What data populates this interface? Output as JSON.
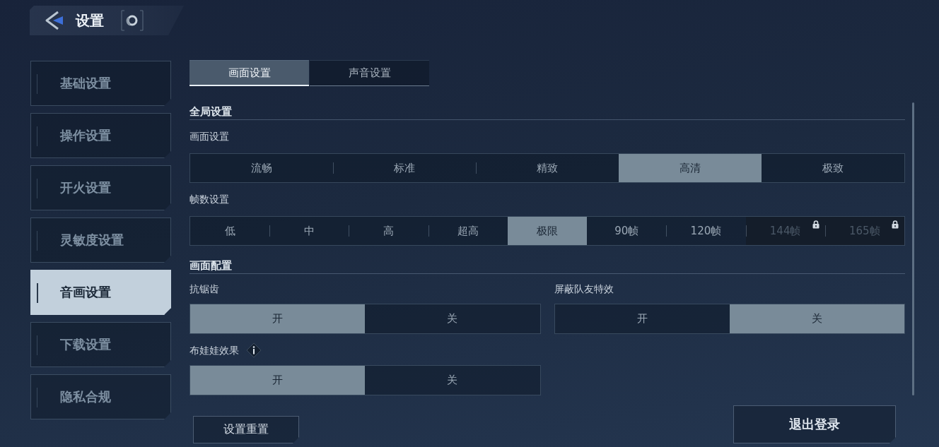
{
  "header": {
    "title": "设置"
  },
  "sidebar": {
    "items": [
      {
        "label": "基础设置",
        "selected": false
      },
      {
        "label": "操作设置",
        "selected": false
      },
      {
        "label": "开火设置",
        "selected": false
      },
      {
        "label": "灵敏度设置",
        "selected": false
      },
      {
        "label": "音画设置",
        "selected": true
      },
      {
        "label": "下载设置",
        "selected": false
      },
      {
        "label": "隐私合规",
        "selected": false
      }
    ]
  },
  "tabs": [
    {
      "label": "画面设置",
      "selected": true
    },
    {
      "label": "声音设置",
      "selected": false
    }
  ],
  "sections": [
    {
      "title": "全局设置",
      "settings": [
        {
          "kind": "segmented",
          "label": "画面设置",
          "info": false,
          "options": [
            {
              "label": "流畅",
              "selected": false,
              "locked": false
            },
            {
              "label": "标准",
              "selected": false,
              "locked": false
            },
            {
              "label": "精致",
              "selected": false,
              "locked": false
            },
            {
              "label": "高清",
              "selected": true,
              "locked": false
            },
            {
              "label": "极致",
              "selected": false,
              "locked": false
            }
          ]
        },
        {
          "kind": "segmented",
          "label": "帧数设置",
          "info": false,
          "options": [
            {
              "label": "低",
              "selected": false,
              "locked": false
            },
            {
              "label": "中",
              "selected": false,
              "locked": false
            },
            {
              "label": "高",
              "selected": false,
              "locked": false
            },
            {
              "label": "超高",
              "selected": false,
              "locked": false
            },
            {
              "label": "极限",
              "selected": true,
              "locked": false
            },
            {
              "label": "90帧",
              "selected": false,
              "locked": false
            },
            {
              "label": "120帧",
              "selected": false,
              "locked": false
            },
            {
              "label": "144帧",
              "selected": false,
              "locked": true
            },
            {
              "label": "165帧",
              "selected": false,
              "locked": true
            }
          ]
        }
      ]
    },
    {
      "title": "画面配置",
      "settings": [
        {
          "kind": "toggle",
          "label": "抗锯齿",
          "info": false,
          "options": [
            {
              "label": "开",
              "selected": true,
              "locked": false
            },
            {
              "label": "关",
              "selected": false,
              "locked": false
            }
          ]
        },
        {
          "kind": "toggle",
          "label": "屏蔽队友特效",
          "info": false,
          "options": [
            {
              "label": "开",
              "selected": false,
              "locked": false
            },
            {
              "label": "关",
              "selected": true,
              "locked": false
            }
          ]
        },
        {
          "kind": "toggle",
          "label": "布娃娃效果",
          "info": true,
          "options": [
            {
              "label": "开",
              "selected": true,
              "locked": false
            },
            {
              "label": "关",
              "selected": false,
              "locked": false
            }
          ]
        }
      ]
    }
  ],
  "footer": {
    "buttons": [
      {
        "kind": "reset",
        "label": "设置重置"
      },
      {
        "kind": "logout",
        "label": "退出登录"
      }
    ]
  }
}
